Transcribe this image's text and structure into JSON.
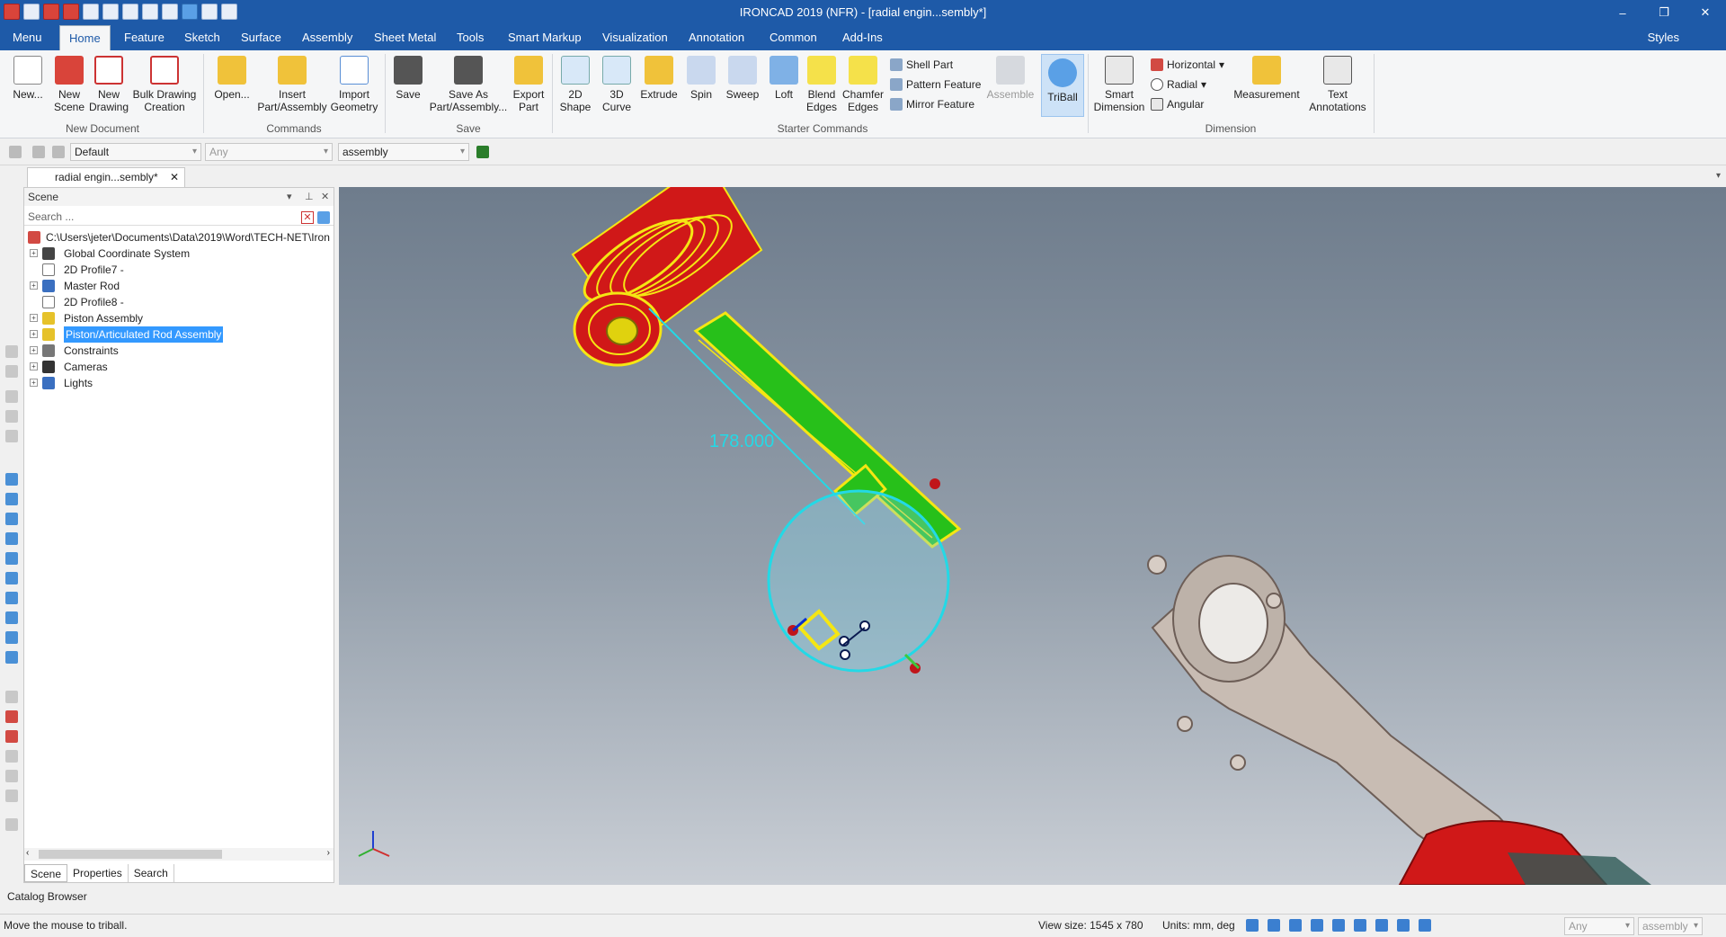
{
  "window": {
    "title": "IRONCAD 2019 (NFR) - [radial engin...sembly*]",
    "controls": [
      "–",
      "❐",
      "✕"
    ]
  },
  "menu_tabs": [
    "Menu",
    "Home",
    "Feature",
    "Sketch",
    "Surface",
    "Assembly",
    "Sheet Metal",
    "Tools",
    "Smart Markup",
    "Visualization",
    "Annotation",
    "Common",
    "Add-Ins"
  ],
  "active_tab": "Home",
  "styles_label": "Styles",
  "ribbon": {
    "new_document": {
      "group": "New Document",
      "new": "New...",
      "new_scene": "New Scene",
      "new_drawing": "New Drawing",
      "bulk_drawing": "Bulk Drawing Creation"
    },
    "commands": {
      "group": "Commands",
      "open": "Open...",
      "insert": "Insert Part/Assembly",
      "import": "Import Geometry"
    },
    "save": {
      "group": "Save",
      "save": "Save",
      "save_as": "Save As Part/Assembly...",
      "export": "Export Part"
    },
    "starter": {
      "group": "Starter Commands",
      "shape2d": "2D Shape",
      "curve3d": "3D Curve",
      "extrude": "Extrude",
      "spin": "Spin",
      "sweep": "Sweep",
      "loft": "Loft",
      "blend": "Blend Edges",
      "chamfer": "Chamfer Edges",
      "shell": "Shell Part",
      "pattern": "Pattern Feature",
      "mirror": "Mirror Feature",
      "assemble": "Assemble",
      "triball": "TriBall"
    },
    "dimension": {
      "group": "Dimension",
      "smart": "Smart Dimension",
      "horizontal": "Horizontal",
      "radial": "Radial",
      "angular": "Angular",
      "measurement": "Measurement",
      "text": "Text Annotations"
    }
  },
  "propbar": {
    "style": "Default",
    "filter": "Any",
    "level": "assembly"
  },
  "doc_tab": "radial engin...sembly*",
  "scene": {
    "title": "Scene",
    "search_placeholder": "Search ...",
    "path": "C:\\Users\\jeter\\Documents\\Data\\2019\\Word\\TECH-NET\\Iron",
    "items": [
      {
        "label": "Global Coordinate System",
        "icon": "coordinate-icon",
        "expandable": true
      },
      {
        "label": "2D Profile7 -",
        "icon": "profile-icon",
        "expandable": false
      },
      {
        "label": "Master Rod",
        "icon": "part-icon",
        "expandable": true
      },
      {
        "label": "2D Profile8 -",
        "icon": "profile-icon",
        "expandable": false
      },
      {
        "label": "Piston Assembly",
        "icon": "assembly-icon",
        "expandable": true
      },
      {
        "label": "Piston/Articulated Rod Assembly",
        "icon": "assembly-icon",
        "expandable": true,
        "selected": true
      },
      {
        "label": "Constraints",
        "icon": "constraints-icon",
        "expandable": true
      },
      {
        "label": "Cameras",
        "icon": "camera-icon",
        "expandable": true
      },
      {
        "label": "Lights",
        "icon": "light-icon",
        "expandable": true
      }
    ],
    "bottom_tabs": [
      "Scene",
      "Properties",
      "Search"
    ]
  },
  "catalog_label": "Catalog Browser",
  "viewport": {
    "dimension_value": "178.000"
  },
  "status": {
    "message": "Move the mouse to triball.",
    "view_size": "View size: 1545 x  780",
    "units": "Units: mm, deg",
    "filter": "Any",
    "level": "assembly"
  },
  "colors": {
    "titlebar": "#1e5aa8",
    "piston_red": "#d01818",
    "rod_green": "#27c01a",
    "highlight_yellow": "#f5e613",
    "triball_cyan": "#23d9e6"
  }
}
